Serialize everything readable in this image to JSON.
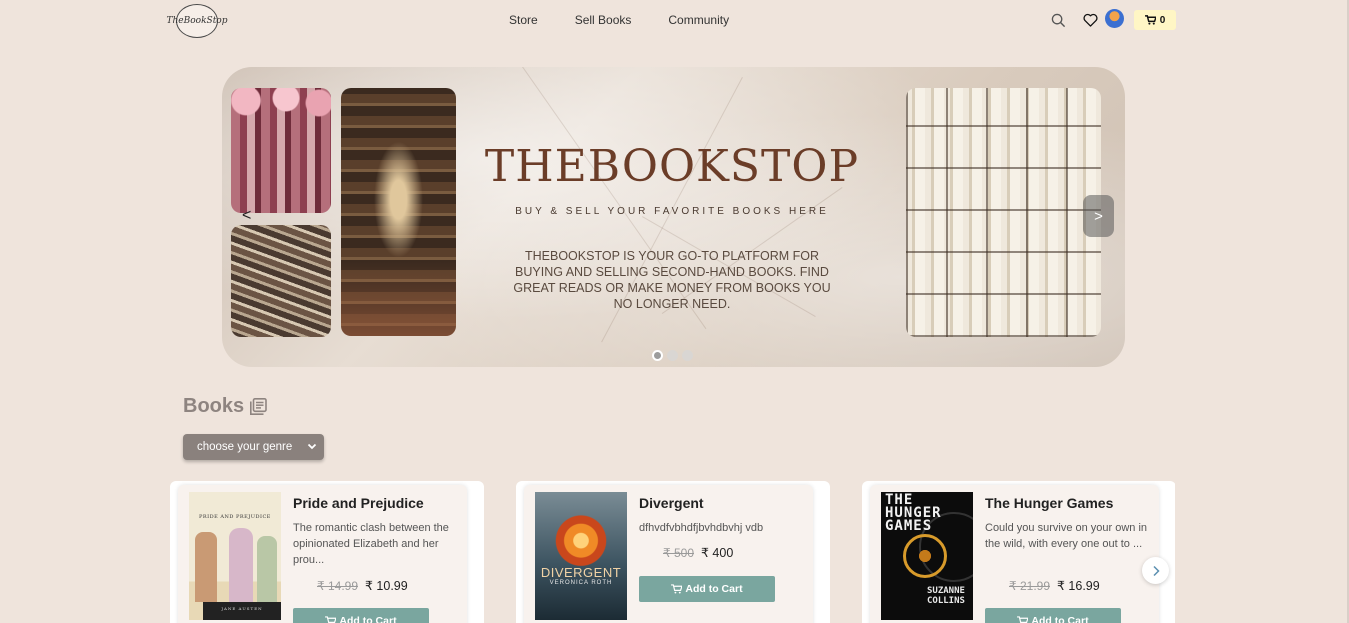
{
  "brand": {
    "logo_text": "TheBookStop"
  },
  "nav": {
    "links": [
      {
        "label": "Store"
      },
      {
        "label": "Sell Books"
      },
      {
        "label": "Community"
      }
    ],
    "cart_count": "0"
  },
  "hero": {
    "title": "THEBOOKSTOP",
    "tagline": "BUY & SELL YOUR FAVORITE BOOKS HERE",
    "description": "THEBOOKSTOP IS YOUR GO-TO PLATFORM FOR BUYING AND SELLING SECOND-HAND BOOKS. FIND GREAT READS OR MAKE MONEY FROM BOOKS YOU NO LONGER NEED.",
    "prev_label": "<",
    "next_label": ">",
    "slides_count": 3,
    "active_slide": 1
  },
  "books_section": {
    "title": "Books",
    "genre_placeholder": "choose your genre",
    "books": [
      {
        "title": "Pride and Prejudice",
        "description": "The romantic clash between the opinionated Elizabeth and her prou...",
        "old_price": "₹ 14.99",
        "price": "₹ 10.99",
        "button": "Add to Cart",
        "cover_title": "PRIDE AND PREJUDICE",
        "cover_author": "JANE AUSTEN"
      },
      {
        "title": "Divergent",
        "description": "dfhvdfvbhdfjbvhdbvhj vdb",
        "old_price": "₹ 500",
        "price": "₹ 400",
        "button": "Add to Cart",
        "cover_title": "DIVERGENT",
        "cover_author": "VERONICA ROTH"
      },
      {
        "title": "The Hunger Games",
        "description": "Could you survive on your own in the wild, with every one out to ...",
        "old_price": "₹ 21.99",
        "price": "₹ 16.99",
        "button": "Add to Cart",
        "cover_title": "THE HUNGER GAMES",
        "cover_author": "SUZANNE COLLINS"
      }
    ]
  },
  "colors": {
    "page_bg": "#efe4dc",
    "hero_title": "#6b3d28",
    "button_bg": "#7aa69f",
    "cart_badge_bg": "#fff6c5"
  }
}
